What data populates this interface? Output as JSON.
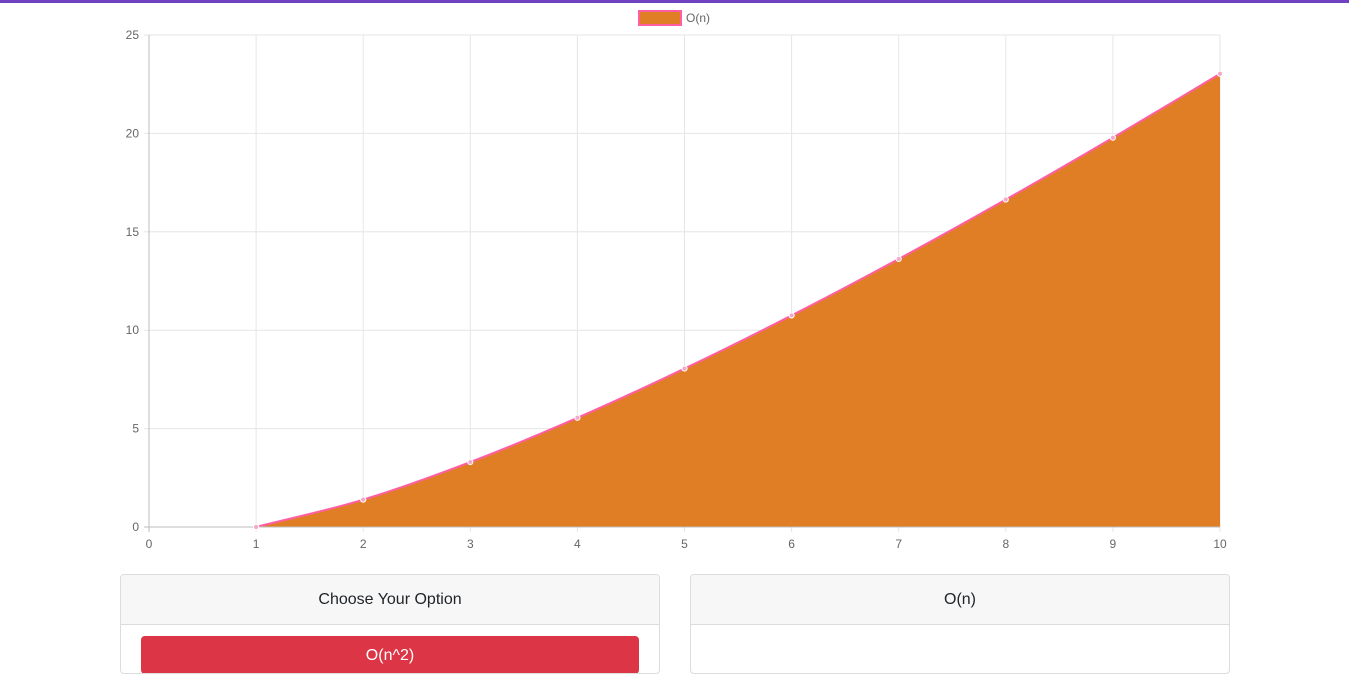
{
  "colors": {
    "top_bar": "#6f42c1",
    "area_fill": "#e07e25",
    "line": "#ff5fa2",
    "grid": "#e6e6e6",
    "axis": "#bdbdbd",
    "tick_text": "#666666",
    "button": "#dc3545"
  },
  "chart_data": {
    "type": "area",
    "legend_position": "top",
    "grid": true,
    "xlim": [
      0,
      10
    ],
    "ylim": [
      0,
      25
    ],
    "x_ticks": [
      "0",
      "1",
      "2",
      "3",
      "4",
      "5",
      "6",
      "7",
      "8",
      "9",
      "10"
    ],
    "y_ticks": [
      "0",
      "5",
      "10",
      "15",
      "20",
      "25"
    ],
    "series": [
      {
        "name": "O(n)",
        "x": [
          1,
          2,
          3,
          4,
          5,
          6,
          7,
          8,
          9,
          10
        ],
        "values": [
          0,
          1.39,
          3.3,
          5.55,
          8.05,
          10.75,
          13.62,
          16.64,
          19.78,
          23.03
        ]
      }
    ]
  },
  "panels": {
    "left": {
      "header": "Choose Your Option",
      "button_label": "O(n^2)"
    },
    "right": {
      "header": "O(n)"
    }
  }
}
